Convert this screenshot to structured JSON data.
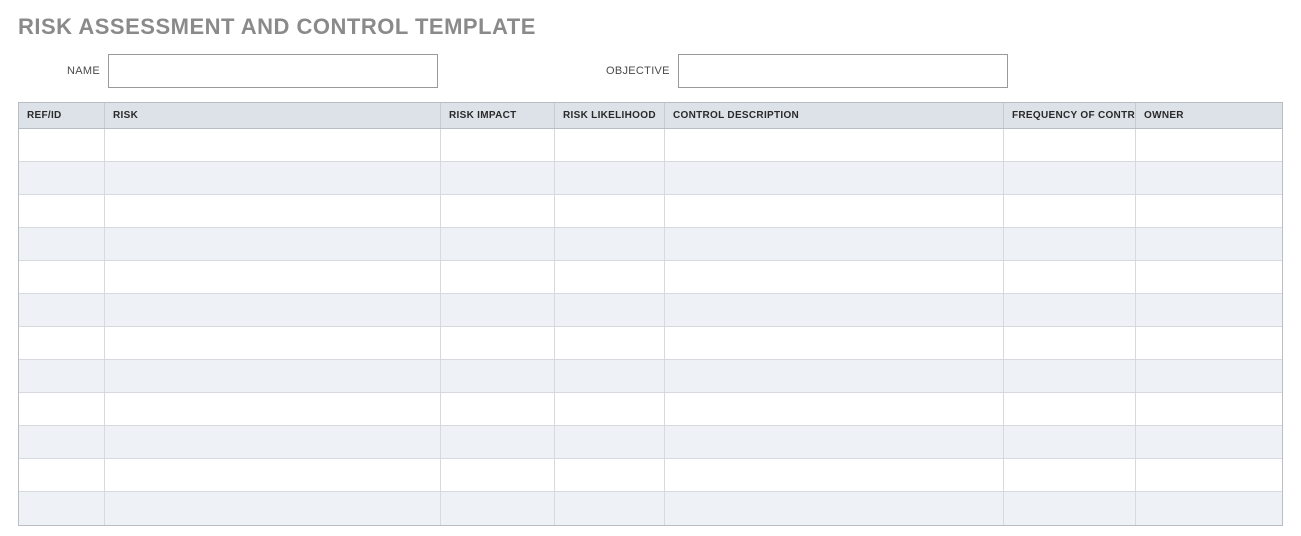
{
  "title": "RISK ASSESSMENT AND CONTROL TEMPLATE",
  "meta": {
    "name_label": "NAME",
    "name_value": "",
    "objective_label": "OBJECTIVE",
    "objective_value": ""
  },
  "columns": {
    "refid": "REF/ID",
    "risk": "RISK",
    "impact": "RISK IMPACT",
    "likelihood": "RISK LIKELIHOOD",
    "control": "CONTROL DESCRIPTION",
    "frequency": "FREQUENCY OF CONTROL",
    "owner": "OWNER"
  },
  "rows": [
    {
      "refid": "",
      "risk": "",
      "impact": "",
      "likelihood": "",
      "control": "",
      "frequency": "",
      "owner": ""
    },
    {
      "refid": "",
      "risk": "",
      "impact": "",
      "likelihood": "",
      "control": "",
      "frequency": "",
      "owner": ""
    },
    {
      "refid": "",
      "risk": "",
      "impact": "",
      "likelihood": "",
      "control": "",
      "frequency": "",
      "owner": ""
    },
    {
      "refid": "",
      "risk": "",
      "impact": "",
      "likelihood": "",
      "control": "",
      "frequency": "",
      "owner": ""
    },
    {
      "refid": "",
      "risk": "",
      "impact": "",
      "likelihood": "",
      "control": "",
      "frequency": "",
      "owner": ""
    },
    {
      "refid": "",
      "risk": "",
      "impact": "",
      "likelihood": "",
      "control": "",
      "frequency": "",
      "owner": ""
    },
    {
      "refid": "",
      "risk": "",
      "impact": "",
      "likelihood": "",
      "control": "",
      "frequency": "",
      "owner": ""
    },
    {
      "refid": "",
      "risk": "",
      "impact": "",
      "likelihood": "",
      "control": "",
      "frequency": "",
      "owner": ""
    },
    {
      "refid": "",
      "risk": "",
      "impact": "",
      "likelihood": "",
      "control": "",
      "frequency": "",
      "owner": ""
    },
    {
      "refid": "",
      "risk": "",
      "impact": "",
      "likelihood": "",
      "control": "",
      "frequency": "",
      "owner": ""
    },
    {
      "refid": "",
      "risk": "",
      "impact": "",
      "likelihood": "",
      "control": "",
      "frequency": "",
      "owner": ""
    },
    {
      "refid": "",
      "risk": "",
      "impact": "",
      "likelihood": "",
      "control": "",
      "frequency": "",
      "owner": ""
    }
  ]
}
